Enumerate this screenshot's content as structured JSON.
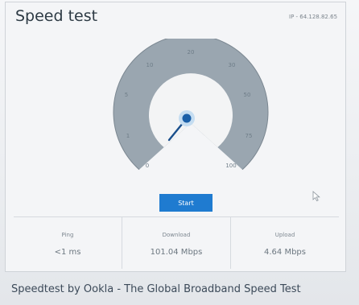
{
  "window": {
    "title": "Speed test",
    "ip_text": "IP - 64.128.82.65"
  },
  "gauge": {
    "ticks": [
      "0",
      "1",
      "5",
      "10",
      "20",
      "30",
      "50",
      "75",
      "100"
    ]
  },
  "controls": {
    "start_label": "Start"
  },
  "stats": {
    "ping_label": "Ping",
    "ping_value": "<1 ms",
    "download_label": "Download",
    "download_value": "101.04 Mbps",
    "upload_label": "Upload",
    "upload_value": "4.64 Mbps"
  },
  "footer": {
    "text": "Speedtest by Ookla - The Global Broadband Speed Test"
  },
  "colors": {
    "accent": "#1f7bd0",
    "needle": "#1a4f8c",
    "gauge_ring": "#9aa6b0"
  }
}
